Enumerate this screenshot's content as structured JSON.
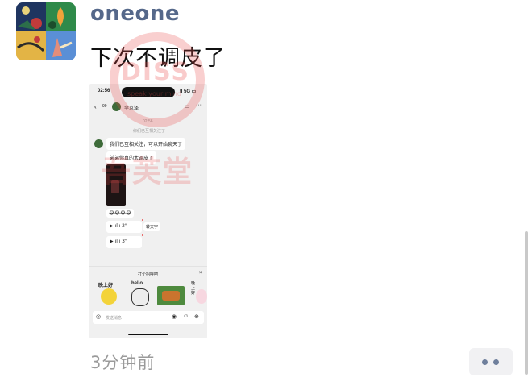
{
  "post": {
    "username": "oneone",
    "text": "下次不调皮了",
    "timestamp": "3分钟前"
  },
  "screenshot": {
    "status_time": "02:56",
    "status_right": "5G",
    "contact_name": "李京泽",
    "time_label": "02:56",
    "system_note": "你们已互相关注了",
    "message1": "我们已互相关注，可以开始聊天了",
    "message2": "弟弟你真的太调皮了",
    "emoji_row": "😂😂😂😂",
    "voice1_duration": "2\"",
    "voice1_action": "转文字",
    "voice2_duration": "3\"",
    "greet_prompt": "打个招呼吧",
    "sticker1_text": "晚上好",
    "sticker2_text": "hello",
    "sticker4_text": "晚上好",
    "input_placeholder": "发送消息"
  },
  "watermark": {
    "circle_text": "DISS",
    "circle_sub": "speak your mind",
    "bottom_text": "吾芙堂"
  },
  "colors": {
    "username": "#55688a",
    "timestamp": "#9a9a9a",
    "watermark": "#e84646",
    "more_dots": "#6f7f9c"
  }
}
